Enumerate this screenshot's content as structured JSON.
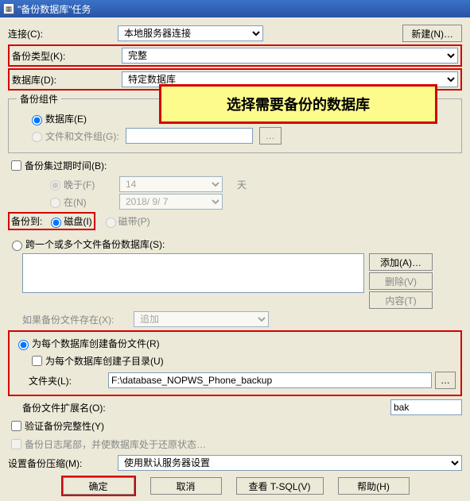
{
  "window": {
    "title": "\"备份数据库\"任务"
  },
  "labels": {
    "connection": "连接(C):",
    "backup_type": "备份类型(K):",
    "database": "数据库(D):",
    "components_group": "备份组件",
    "component_db": "数据库(E)",
    "component_files": "文件和文件组(G):",
    "expire_chk": "备份集过期时间(B):",
    "expire_after": "晚于(F)",
    "expire_on": "在(N)",
    "days": "天",
    "backup_to": "备份到:",
    "to_disk": "磁盘(I)",
    "to_tape": "磁带(P)",
    "across_files": "跨一个或多个文件备份数据库(S):",
    "if_exists": "如果备份文件存在(X):",
    "per_db_file": "为每个数据库创建备份文件(R)",
    "per_db_subdir": "为每个数据库创建子目录(U)",
    "folder": "文件夹(L):",
    "ext": "备份文件扩展名(O):",
    "verify": "验证备份完整性(Y)",
    "log_tail": "备份日志尾部，并使数据库处于还原状态…",
    "compress": "设置备份压缩(M):"
  },
  "values": {
    "connection": "本地服务器连接",
    "backup_type": "完整",
    "database": "特定数据库",
    "expire_days": "14",
    "expire_date": "2018/ 9/ 7",
    "if_exists_opt": "追加",
    "folder_path": "F:\\database_NOPWS_Phone_backup",
    "ext_value": "bak",
    "compress_opt": "使用默认服务器设置"
  },
  "buttons": {
    "new": "新建(N)…",
    "add": "添加(A)…",
    "remove": "删除(V)",
    "contents": "内容(T)",
    "ellipsis": "…",
    "fg_ellipsis": "…",
    "ok": "确定",
    "cancel": "取消",
    "view_tsql": "查看 T-SQL(V)",
    "help": "帮助(H)"
  },
  "callout": "选择需要备份的数据库"
}
